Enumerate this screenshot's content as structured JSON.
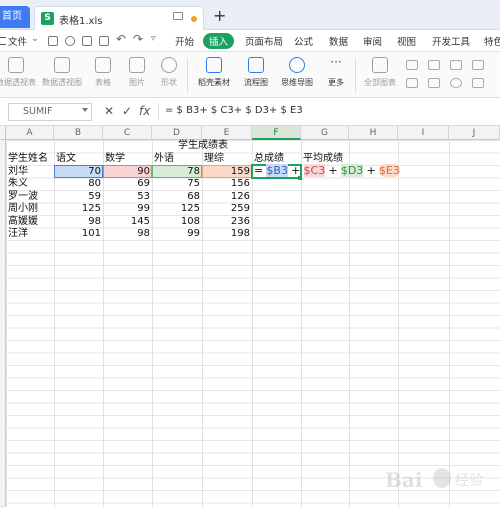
{
  "titlebar": {
    "home_tab": "首页",
    "file_tab": "表格1.xls",
    "add_tab": "+"
  },
  "menubar": {
    "file_menu": "文件",
    "tabs": [
      "开始",
      "插入",
      "页面布局",
      "公式",
      "数据",
      "审阅",
      "视图",
      "开发工具",
      "特色"
    ],
    "active_tab": "插入"
  },
  "ribbon": {
    "buttons": [
      "数据透视表",
      "数据透视图",
      "表格",
      "图片",
      "形状",
      "稻壳素材",
      "流程图",
      "思维导图",
      "更多",
      "全部图表"
    ]
  },
  "formula_bar": {
    "name_box": "SUMIF",
    "cancel": "✕",
    "confirm": "✓",
    "fx": "fx",
    "formula": "= $ B3+ $ C3+ $ D3+ $ E3"
  },
  "sheet": {
    "columns": [
      "A",
      "B",
      "C",
      "D",
      "E",
      "F",
      "G",
      "H",
      "I",
      "J"
    ],
    "selected_column": "F",
    "title": "学生成绩表",
    "headers": [
      "学生姓名",
      "语文",
      "数学",
      "外语",
      "理综",
      "总成绩",
      "平均成绩"
    ],
    "rows": [
      {
        "name": "刘华",
        "chinese": "70",
        "math": "90",
        "english": "78",
        "science": "159"
      },
      {
        "name": "朱义",
        "chinese": "80",
        "math": "69",
        "english": "75",
        "science": "156"
      },
      {
        "name": "罗一波",
        "chinese": "59",
        "math": "53",
        "english": "68",
        "science": "126"
      },
      {
        "name": "周小刚",
        "chinese": "125",
        "math": "99",
        "english": "125",
        "science": "259"
      },
      {
        "name": "高媛媛",
        "chinese": "98",
        "math": "145",
        "english": "108",
        "science": "236"
      },
      {
        "name": "汪洋",
        "chinese": "101",
        "math": "98",
        "english": "99",
        "science": "198"
      }
    ],
    "editing_cell": {
      "eq": "=",
      "ref1": "$B3",
      "plus1": "+",
      "ref2": "$C3",
      "plus2": "+",
      "ref3": "$D3",
      "plus3": "+",
      "ref4": "$E3"
    }
  },
  "watermark": {
    "brand": "Bai",
    "suffix": "经验"
  },
  "colors": {
    "accent_green": "#1aa260",
    "home_blue": "#3e7bf0",
    "ref_blue": "#c9daf6",
    "ref_red": "#f7d3d3",
    "ref_green": "#d6ecd6",
    "ref_orange": "#fbd8c7"
  }
}
